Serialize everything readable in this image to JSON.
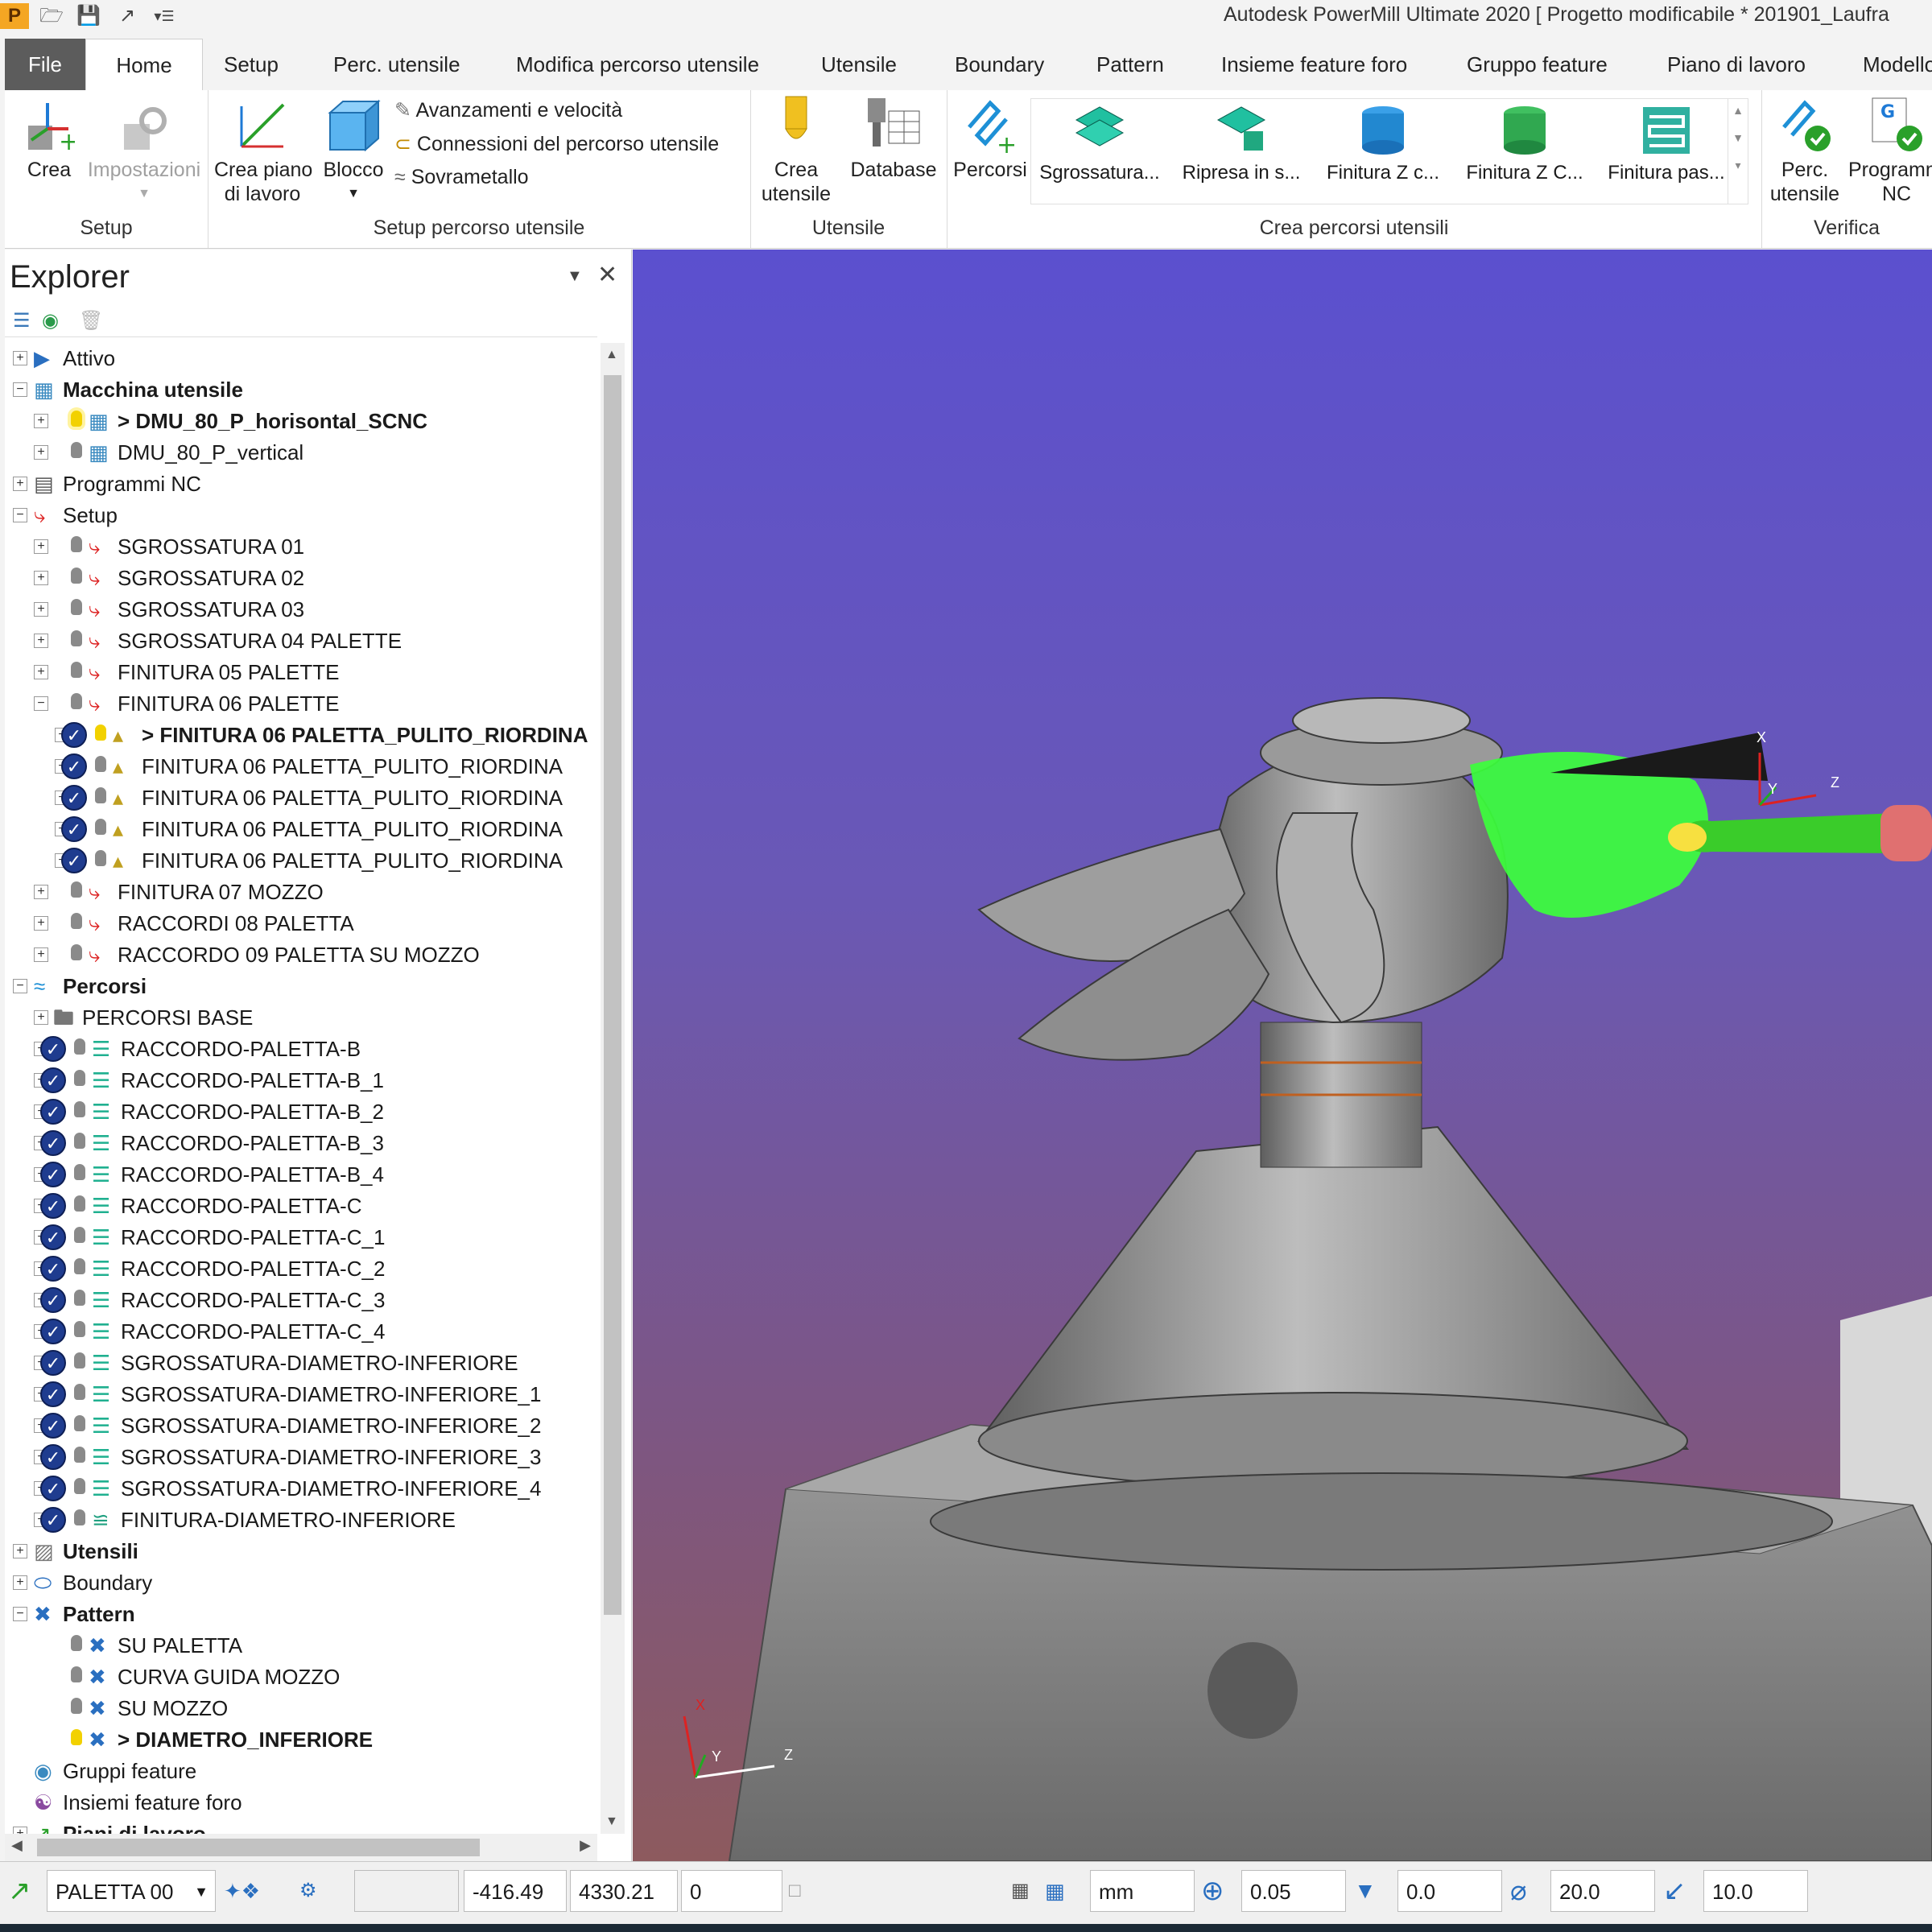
{
  "titlebar": {
    "title": "Autodesk PowerMill Ultimate 2020    [ Progetto modificabile * 201901_Laufra",
    "app_icon": "P"
  },
  "tabs": [
    "File",
    "Home",
    "Setup",
    "Perc. utensile",
    "Modifica percorso utensile",
    "Utensile",
    "Boundary",
    "Pattern",
    "Insieme feature foro",
    "Gruppo feature",
    "Piano di lavoro",
    "Modello"
  ],
  "ribbon": {
    "setup_group": {
      "crea": "Crea",
      "impostazioni": "Impostazioni",
      "label": "Setup"
    },
    "setup_percorso": {
      "crea_piano_l1": "Crea piano",
      "crea_piano_l2": "di lavoro",
      "blocco": "Blocco",
      "avanzamenti": "Avanzamenti e velocità",
      "connessioni": "Connessioni del percorso utensile",
      "sovrametallo": "Sovrametallo",
      "label": "Setup percorso utensile"
    },
    "utensile_group": {
      "crea_l1": "Crea",
      "crea_l2": "utensile",
      "database": "Database",
      "label": "Utensile"
    },
    "crea_percorsi": {
      "percorsi": "Percorsi",
      "gallery": [
        "Sgrossatura...",
        "Ripresa in s...",
        "Finitura Z c...",
        "Finitura Z C...",
        "Finitura pas..."
      ],
      "label": "Crea percorsi utensili"
    },
    "verifica": {
      "perc_l1": "Perc.",
      "perc_l2": "utensile",
      "prog_l1": "Programmi",
      "prog_l2": "NC",
      "label": "Verifica"
    }
  },
  "explorer": {
    "title": "Explorer",
    "rows": [
      {
        "t": "Attivo",
        "x": 0,
        "pm": "+",
        "icon": "active",
        "bold": false
      },
      {
        "t": "Macchina utensile",
        "x": 0,
        "pm": "-",
        "icon": "machine",
        "bold": true
      },
      {
        "t": "> DMU_80_P_horisontal_SCNC",
        "x": 1,
        "pm": "+",
        "icon": "machine",
        "bold": true,
        "bulb": "sun"
      },
      {
        "t": "DMU_80_P_vertical",
        "x": 1,
        "pm": "+",
        "icon": "machine",
        "bold": false,
        "bulb": "off"
      },
      {
        "t": "Programmi NC",
        "x": 0,
        "pm": "+",
        "icon": "nc",
        "bold": false
      },
      {
        "t": "Setup",
        "x": 0,
        "pm": "-",
        "icon": "setup",
        "bold": false
      },
      {
        "t": "SGROSSATURA 01",
        "x": 1,
        "pm": "+",
        "icon": "setup",
        "bold": false,
        "bulb": "off"
      },
      {
        "t": "SGROSSATURA 02",
        "x": 1,
        "pm": "+",
        "icon": "setup",
        "bold": false,
        "bulb": "off"
      },
      {
        "t": "SGROSSATURA 03",
        "x": 1,
        "pm": "+",
        "icon": "setup",
        "bold": false,
        "bulb": "off"
      },
      {
        "t": "SGROSSATURA 04 PALETTE",
        "x": 1,
        "pm": "+",
        "icon": "setup",
        "bold": false,
        "bulb": "off"
      },
      {
        "t": "FINITURA 05 PALETTE",
        "x": 1,
        "pm": "+",
        "icon": "setup",
        "bold": false,
        "bulb": "off"
      },
      {
        "t": "FINITURA 06 PALETTE",
        "x": 1,
        "pm": "-",
        "icon": "setup",
        "bold": false,
        "bulb": "off"
      },
      {
        "t": "> FINITURA 06 PALETTA_PULITO_RIORDINA",
        "x": 2,
        "pm": "+",
        "icon": "path",
        "bold": true,
        "bulb": "on",
        "chk": true
      },
      {
        "t": "FINITURA 06 PALETTA_PULITO_RIORDINA",
        "x": 2,
        "pm": "+",
        "icon": "path",
        "bold": false,
        "bulb": "off",
        "chk": true
      },
      {
        "t": "FINITURA 06 PALETTA_PULITO_RIORDINA",
        "x": 2,
        "pm": "+",
        "icon": "path",
        "bold": false,
        "bulb": "off",
        "chk": true
      },
      {
        "t": "FINITURA 06 PALETTA_PULITO_RIORDINA",
        "x": 2,
        "pm": "+",
        "icon": "path",
        "bold": false,
        "bulb": "off",
        "chk": true
      },
      {
        "t": "FINITURA 06 PALETTA_PULITO_RIORDINA",
        "x": 2,
        "pm": "+",
        "icon": "path",
        "bold": false,
        "bulb": "off",
        "chk": true
      },
      {
        "t": "FINITURA 07 MOZZO",
        "x": 1,
        "pm": "+",
        "icon": "setup",
        "bold": false,
        "bulb": "off"
      },
      {
        "t": "RACCORDI 08 PALETTA",
        "x": 1,
        "pm": "+",
        "icon": "setup",
        "bold": false,
        "bulb": "off"
      },
      {
        "t": "RACCORDO 09 PALETTA SU MOZZO",
        "x": 1,
        "pm": "+",
        "icon": "setup",
        "bold": false,
        "bulb": "off"
      },
      {
        "t": "Percorsi",
        "x": 0,
        "pm": "-",
        "icon": "percorsi",
        "bold": true
      },
      {
        "t": "PERCORSI BASE",
        "x": 1,
        "pm": "+",
        "icon": "folder",
        "bold": false
      },
      {
        "t": "RACCORDO-PALETTA-B",
        "x": 1,
        "pm": "+",
        "icon": "layers",
        "bold": false,
        "bulb": "off",
        "chk": true
      },
      {
        "t": "RACCORDO-PALETTA-B_1",
        "x": 1,
        "pm": "+",
        "icon": "layers",
        "bold": false,
        "bulb": "off",
        "chk": true
      },
      {
        "t": "RACCORDO-PALETTA-B_2",
        "x": 1,
        "pm": "+",
        "icon": "layers",
        "bold": false,
        "bulb": "off",
        "chk": true
      },
      {
        "t": "RACCORDO-PALETTA-B_3",
        "x": 1,
        "pm": "+",
        "icon": "layers",
        "bold": false,
        "bulb": "off",
        "chk": true
      },
      {
        "t": "RACCORDO-PALETTA-B_4",
        "x": 1,
        "pm": "+",
        "icon": "layers",
        "bold": false,
        "bulb": "off",
        "chk": true
      },
      {
        "t": "RACCORDO-PALETTA-C",
        "x": 1,
        "pm": "+",
        "icon": "layers",
        "bold": false,
        "bulb": "off",
        "chk": true
      },
      {
        "t": "RACCORDO-PALETTA-C_1",
        "x": 1,
        "pm": "+",
        "icon": "layers",
        "bold": false,
        "bulb": "off",
        "chk": true
      },
      {
        "t": "RACCORDO-PALETTA-C_2",
        "x": 1,
        "pm": "+",
        "icon": "layers",
        "bold": false,
        "bulb": "off",
        "chk": true
      },
      {
        "t": "RACCORDO-PALETTA-C_3",
        "x": 1,
        "pm": "+",
        "icon": "layers",
        "bold": false,
        "bulb": "off",
        "chk": true
      },
      {
        "t": "RACCORDO-PALETTA-C_4",
        "x": 1,
        "pm": "+",
        "icon": "layers",
        "bold": false,
        "bulb": "off",
        "chk": true
      },
      {
        "t": "SGROSSATURA-DIAMETRO-INFERIORE",
        "x": 1,
        "pm": "+",
        "icon": "layers",
        "bold": false,
        "bulb": "off",
        "chk": true
      },
      {
        "t": "SGROSSATURA-DIAMETRO-INFERIORE_1",
        "x": 1,
        "pm": "+",
        "icon": "layers",
        "bold": false,
        "bulb": "off",
        "chk": true
      },
      {
        "t": "SGROSSATURA-DIAMETRO-INFERIORE_2",
        "x": 1,
        "pm": "+",
        "icon": "layers",
        "bold": false,
        "bulb": "off",
        "chk": true
      },
      {
        "t": "SGROSSATURA-DIAMETRO-INFERIORE_3",
        "x": 1,
        "pm": "+",
        "icon": "layers",
        "bold": false,
        "bulb": "off",
        "chk": true
      },
      {
        "t": "SGROSSATURA-DIAMETRO-INFERIORE_4",
        "x": 1,
        "pm": "+",
        "icon": "layers",
        "bold": false,
        "bulb": "off",
        "chk": true
      },
      {
        "t": "FINITURA-DIAMETRO-INFERIORE",
        "x": 1,
        "pm": "+",
        "icon": "finish",
        "bold": false,
        "bulb": "off",
        "chk": true
      },
      {
        "t": "Utensili",
        "x": 0,
        "pm": "+",
        "icon": "tools",
        "bold": true
      },
      {
        "t": "Boundary",
        "x": 0,
        "pm": "+",
        "icon": "boundary",
        "bold": false
      },
      {
        "t": "Pattern",
        "x": 0,
        "pm": "-",
        "icon": "pattern",
        "bold": true
      },
      {
        "t": "SU PALETTA",
        "x": 1,
        "pm": "",
        "icon": "pattern",
        "bold": false,
        "bulb": "off"
      },
      {
        "t": "CURVA GUIDA MOZZO",
        "x": 1,
        "pm": "",
        "icon": "pattern",
        "bold": false,
        "bulb": "off"
      },
      {
        "t": "SU MOZZO",
        "x": 1,
        "pm": "",
        "icon": "pattern",
        "bold": false,
        "bulb": "off"
      },
      {
        "t": "> DIAMETRO_INFERIORE",
        "x": 1,
        "pm": "",
        "icon": "pattern",
        "bold": true,
        "bulb": "on"
      },
      {
        "t": "Gruppi feature",
        "x": 0,
        "pm": "",
        "icon": "feature",
        "bold": false
      },
      {
        "t": "Insiemi feature foro",
        "x": 0,
        "pm": "",
        "icon": "hole",
        "bold": false
      },
      {
        "t": "Piani di lavoro",
        "x": 0,
        "pm": "+",
        "icon": "workplane",
        "bold": true
      }
    ]
  },
  "viewport": {
    "axis_x": "X",
    "axis_y": "Y",
    "axis_z": "Z"
  },
  "status": {
    "workplane": "PALETTA 00",
    "x": "-416.49",
    "y": "4330.21",
    "z": "0",
    "units": "mm",
    "tolerance": "0.05",
    "thickness": "0.0",
    "diameter": "20.0",
    "stepover": "10.0"
  }
}
